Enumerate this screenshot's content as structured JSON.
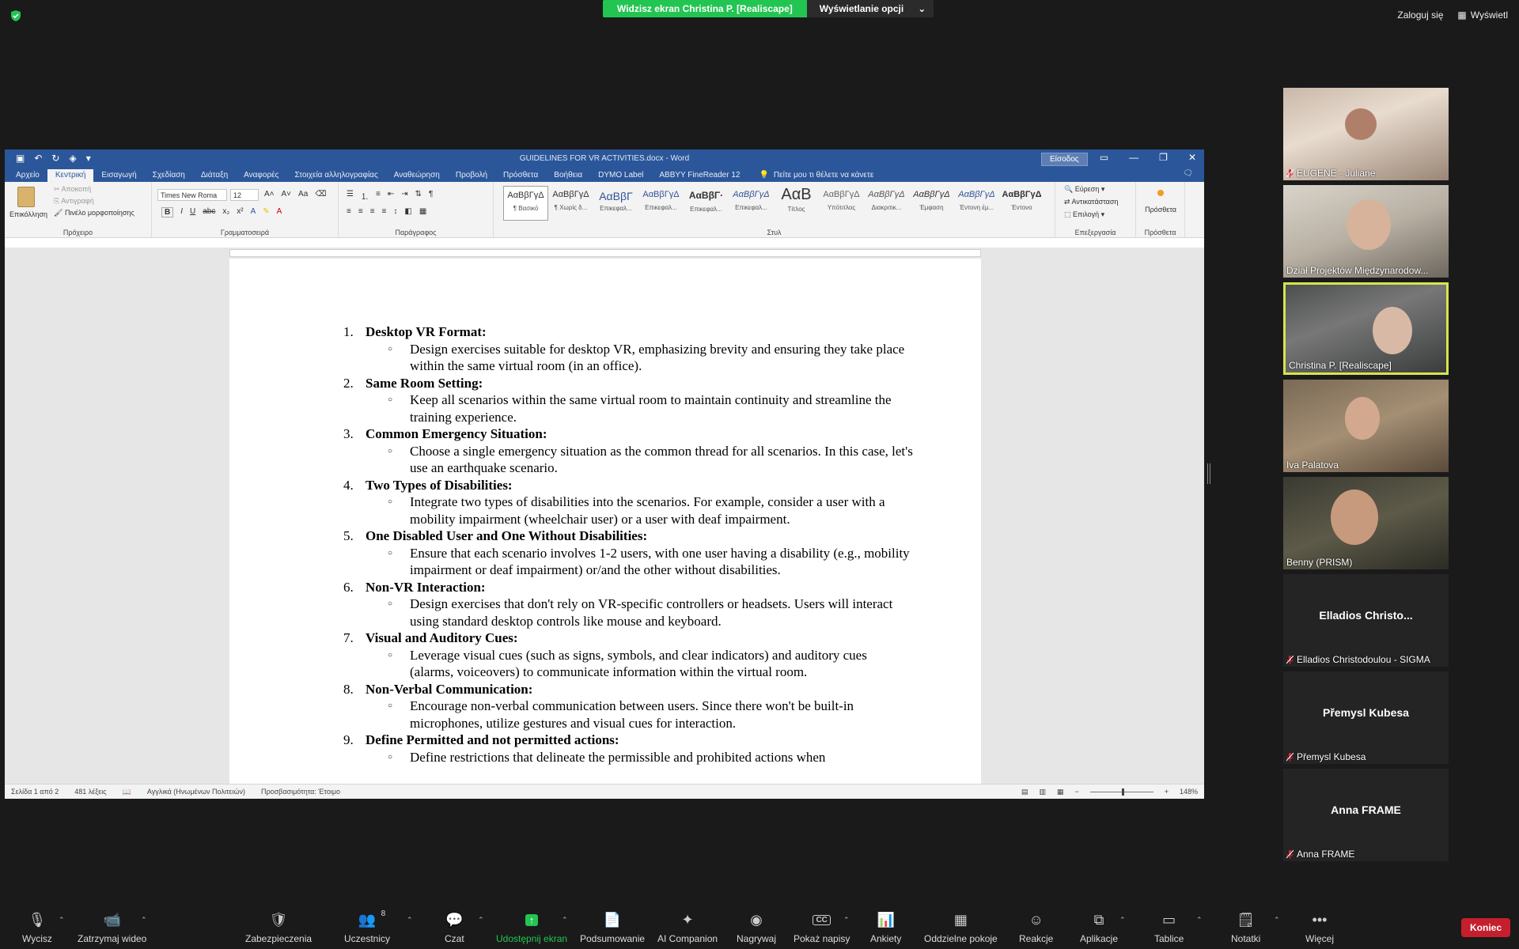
{
  "zoom": {
    "share_banner": "Widzisz ekran Christina P. [Realiscape]",
    "view_options": "Wyświetlanie opcji",
    "signin": "Zaloguj się",
    "view": "Wyświetl",
    "end_button": "Koniec"
  },
  "word": {
    "title": "GUIDELINES FOR VR ACTIVITIES.docx  -  Word",
    "signin": "Είσοδος",
    "tabs": [
      "Αρχείο",
      "Κεντρική",
      "Εισαγωγή",
      "Σχεδίαση",
      "Διάταξη",
      "Αναφορές",
      "Στοιχεία αλληλογραφίας",
      "Αναθεώρηση",
      "Προβολή",
      "Πρόσθετα",
      "Βοήθεια",
      "DYMO Label",
      "ABBYY FineReader 12"
    ],
    "tell_me": "Πείτε μου τι θέλετε να κάνετε",
    "clipboard": {
      "paste": "Επικόλληση",
      "cut": "Αποκοπή",
      "copy": "Αντιγραφή",
      "format_painter": "Πινέλο μορφοποίησης",
      "label": "Πρόχειρο"
    },
    "font": {
      "name": "Times New Roma",
      "size": "12",
      "label": "Γραμματοσειρά"
    },
    "paragraph_label": "Παράγραφος",
    "styles_label": "Στυλ",
    "styles": [
      {
        "preview": "ΑαΒβΓγΔ",
        "name": "¶ Βασικό"
      },
      {
        "preview": "ΑαΒβΓγΔ",
        "name": "¶ Χωρίς δ..."
      },
      {
        "preview": "ΑαΒβΓ",
        "name": "Επικεφαλ..."
      },
      {
        "preview": "ΑαΒβΓγΔ",
        "name": "Επικεφαλ..."
      },
      {
        "preview": "ΑαΒβΓ·",
        "name": "Επικεφαλ..."
      },
      {
        "preview": "ΑαΒβΓγΔ",
        "name": "Επικεφαλ..."
      },
      {
        "preview": "ΑαΒ",
        "name": "Τίτλος"
      },
      {
        "preview": "ΑαΒβΓγΔ",
        "name": "Υπότιτλος"
      },
      {
        "preview": "ΑαΒβΓγΔ",
        "name": "Διακριτικ..."
      },
      {
        "preview": "ΑαΒβΓγΔ",
        "name": "Έμφαση"
      },
      {
        "preview": "ΑαΒβΓγΔ",
        "name": "Έντονη έμ..."
      },
      {
        "preview": "ΑαΒβΓγΔ",
        "name": "Έντονο"
      }
    ],
    "editing": {
      "find": "Εύρεση",
      "replace": "Αντικατάσταση",
      "select": "Επιλογή",
      "label": "Επεξεργασία"
    },
    "addins": {
      "button": "Πρόσθετα",
      "label": "Πρόσθετα"
    },
    "status": {
      "page": "Σελίδα 1 από 2",
      "words": "481 λέξεις",
      "language": "Αγγλικά (Ηνωμένων Πολιτειών)",
      "accessibility": "Προσβασιμότητα: Έτοιμο",
      "zoom": "148%"
    },
    "document": [
      {
        "num": "1.",
        "heading": "Desktop VR Format:",
        "text": "Design exercises suitable for desktop VR, emphasizing brevity and ensuring they take place within the same virtual room (in an office)."
      },
      {
        "num": "2.",
        "heading": "Same Room Setting:",
        "text": "Keep all scenarios within the same virtual room to maintain continuity and streamline the training experience."
      },
      {
        "num": "3.",
        "heading": "Common Emergency Situation:",
        "text": "Choose a single emergency situation as the common thread for all scenarios. In this case, let's use an earthquake scenario."
      },
      {
        "num": "4.",
        "heading": "Two Types of Disabilities:",
        "text": "Integrate two types of disabilities into the scenarios. For example, consider a user with a mobility impairment (wheelchair user) or a user with deaf impairment."
      },
      {
        "num": "5.",
        "heading": "One Disabled User and One Without Disabilities:",
        "text": "Ensure that each scenario involves 1-2 users, with one user having a disability (e.g., mobility impairment or deaf impairment) or/and the other without disabilities."
      },
      {
        "num": "6.",
        "heading": "Non-VR Interaction:",
        "text": "Design exercises that don't rely on VR-specific controllers or headsets. Users will interact using standard desktop controls like mouse and keyboard."
      },
      {
        "num": "7.",
        "heading": "Visual and Auditory Cues:",
        "text": "Leverage visual cues (such as signs, symbols, and clear indicators) and auditory cues (alarms, voiceovers) to communicate information within the virtual room."
      },
      {
        "num": "8.",
        "heading": "Non-Verbal Communication:",
        "text": "Encourage non-verbal communication between users. Since there won't be built-in microphones, utilize gestures and visual cues for interaction."
      },
      {
        "num": "9.",
        "heading": "Define Permitted and not permitted actions:",
        "text": "Define restrictions that delineate the permissible and prohibited actions when"
      }
    ]
  },
  "participants": [
    {
      "name": "EUGENE - Juliane",
      "muted": true,
      "video": true
    },
    {
      "name": "Dział Projektów Międzynarodow...",
      "muted": false,
      "video": true
    },
    {
      "name": "Christina P. [Realiscape]",
      "muted": false,
      "video": true,
      "active": true
    },
    {
      "name": "Iva Palatova",
      "muted": false,
      "video": true
    },
    {
      "name": "Benny (PRISM)",
      "muted": false,
      "video": true
    },
    {
      "name": "Elladios Christodoulou - SIGMA",
      "display": "Elladios  Christo...",
      "muted": true,
      "video": false
    },
    {
      "name": "Přemysl Kubesa",
      "display": "Přemysl Kubesa",
      "muted": true,
      "video": false
    },
    {
      "name": "Anna FRAME",
      "display": "Anna FRAME",
      "muted": true,
      "video": false
    }
  ],
  "toolbar": {
    "mute": "Wycisz",
    "stop_video": "Zatrzymaj wideo",
    "security": "Zabezpieczenia",
    "participants": "Uczestnicy",
    "participants_count": "8",
    "chat": "Czat",
    "share": "Udostępnij ekran",
    "summary": "Podsumowanie",
    "ai": "AI Companion",
    "record": "Nagrywaj",
    "captions": "Pokaż napisy",
    "polls": "Ankiety",
    "breakout": "Oddzielne pokoje",
    "reactions": "Reakcje",
    "apps": "Aplikacje",
    "whiteboards": "Tablice",
    "notes": "Notatki",
    "more": "Więcej",
    "cc_icon_text": "CC"
  },
  "colors": {
    "zoom_green": "#23c552",
    "word_blue": "#2b579a",
    "end_red": "#c51f2d",
    "active_speaker": "#d7e44e"
  }
}
